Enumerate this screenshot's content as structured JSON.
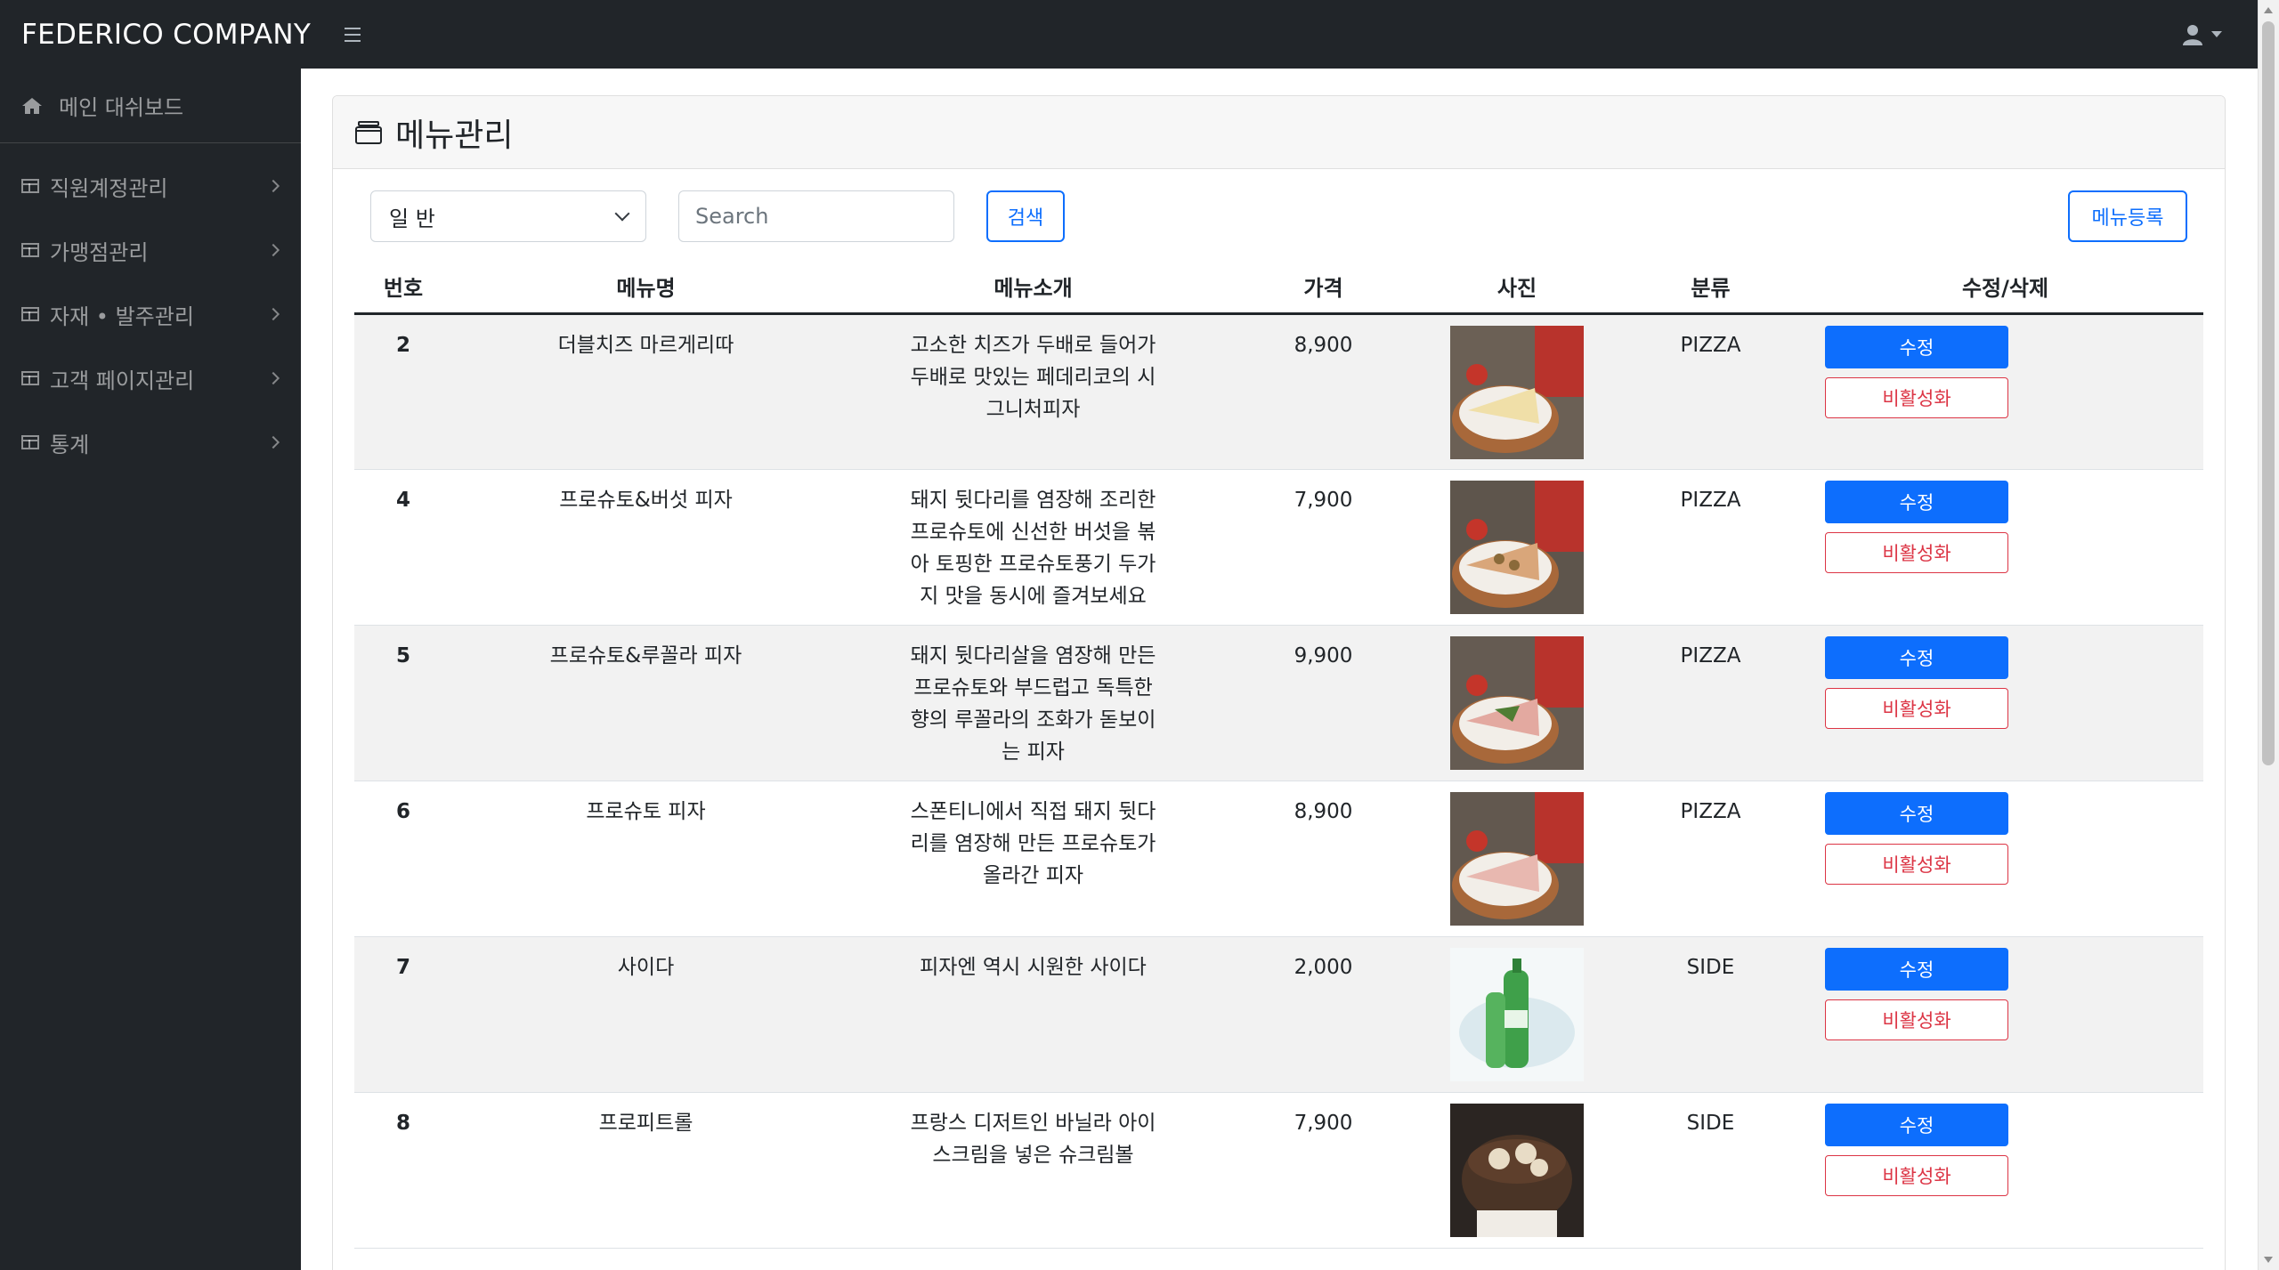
{
  "navbar": {
    "brand": "FEDERICO COMPANY"
  },
  "sidebar": {
    "dashboard": "메인 대쉬보드",
    "items": [
      {
        "label": "직원계정관리"
      },
      {
        "label": "가맹점관리"
      },
      {
        "label": "자재 • 발주관리"
      },
      {
        "label": "고객 페이지관리"
      },
      {
        "label": "통계"
      }
    ]
  },
  "page": {
    "title": "메뉴관리"
  },
  "filters": {
    "category_selected": "일 반",
    "search_placeholder": "Search",
    "search_button": "검색",
    "register_button": "메뉴등록"
  },
  "table": {
    "headers": [
      "번호",
      "메뉴명",
      "메뉴소개",
      "가격",
      "사진",
      "분류",
      "수정/삭제"
    ],
    "edit_label": "수정",
    "deactivate_label": "비활성화",
    "rows": [
      {
        "no": "2",
        "name": "더블치즈 마르게리따",
        "desc": "고소한 치즈가 두배로 들어가 두배로 맛있는 페데리코의 시그니처피자",
        "price": "8,900",
        "category": "PIZZA",
        "image": "pizza-margherita"
      },
      {
        "no": "4",
        "name": "프로슈토&버섯 피자",
        "desc": "돼지 뒷다리를 염장해 조리한 프로슈토에 신선한 버섯을 볶아 토핑한 프로슈토풍기 두가지 맛을 동시에 즐겨보세요",
        "price": "7,900",
        "category": "PIZZA",
        "image": "pizza-mushroom"
      },
      {
        "no": "5",
        "name": "프로슈토&루꼴라 피자",
        "desc": "돼지 뒷다리살을 염장해 만든 프로슈토와 부드럽고 독특한 향의 루꼴라의 조화가 돋보이는 피자",
        "price": "9,900",
        "category": "PIZZA",
        "image": "pizza-arugula"
      },
      {
        "no": "6",
        "name": "프로슈토 피자",
        "desc": "스폰티니에서 직접 돼지 뒷다리를 염장해 만든 프로슈토가 올라간 피자",
        "price": "8,900",
        "category": "PIZZA",
        "image": "pizza-prosciutto"
      },
      {
        "no": "7",
        "name": "사이다",
        "desc": "피자엔 역시 시원한 사이다",
        "price": "2,000",
        "category": "SIDE",
        "image": "cider-bottle"
      },
      {
        "no": "8",
        "name": "프로피트롤",
        "desc": "프랑스 디저트인 바닐라 아이스크림을 넣은 슈크림볼",
        "price": "7,900",
        "category": "SIDE",
        "image": "profiterole-dessert"
      }
    ]
  }
}
